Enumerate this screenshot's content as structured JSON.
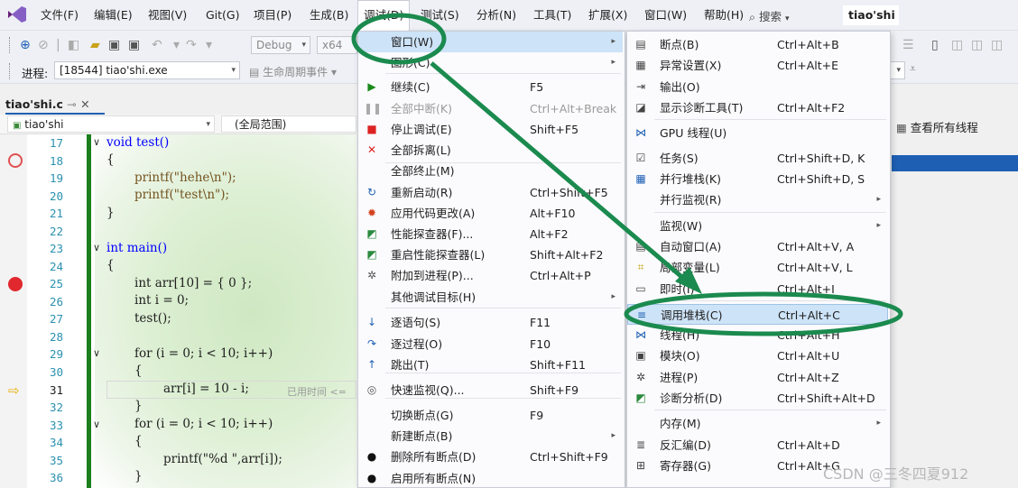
{
  "menubar": {
    "items": [
      "文件(F)",
      "编辑(E)",
      "视图(V)",
      "Git(G)",
      "项目(P)",
      "生成(B)",
      "调试(D)",
      "测试(S)",
      "分析(N)",
      "工具(T)",
      "扩展(X)",
      "窗口(W)",
      "帮助(H)"
    ],
    "search": "搜索",
    "solution": "tiao'shi"
  },
  "toolbar": {
    "config": "Debug",
    "platform": "x64",
    "process_label": "进程:",
    "process_value": "[18544] tiao'shi.exe",
    "lifecycle": "生命周期事件",
    "threads_button": "查看所有线程"
  },
  "editor": {
    "tab": "tiao'shi.c",
    "project_combo": "tiao'shi",
    "scope_combo": "(全局范围)",
    "lines": [
      {
        "n": "17",
        "text": "void test()"
      },
      {
        "n": "18",
        "text": "{"
      },
      {
        "n": "19",
        "text": "printf(\"hehe\\n\");"
      },
      {
        "n": "20",
        "text": "printf(\"test\\n\");"
      },
      {
        "n": "21",
        "text": "}"
      },
      {
        "n": "22",
        "text": ""
      },
      {
        "n": "23",
        "text": "int main()"
      },
      {
        "n": "24",
        "text": "{"
      },
      {
        "n": "25",
        "text": "int arr[10] = { 0 };"
      },
      {
        "n": "26",
        "text": "int i = 0;"
      },
      {
        "n": "27",
        "text": "test();"
      },
      {
        "n": "28",
        "text": ""
      },
      {
        "n": "29",
        "text": "for (i = 0; i < 10; i++)"
      },
      {
        "n": "30",
        "text": "{"
      },
      {
        "n": "31",
        "text": "arr[i] = 10 - i;"
      },
      {
        "n": "32",
        "text": "}"
      },
      {
        "n": "33",
        "text": "for (i = 0; i < 10; i++)"
      },
      {
        "n": "34",
        "text": "{"
      },
      {
        "n": "35",
        "text": "printf(\"%d \",arr[i]);"
      },
      {
        "n": "36",
        "text": "}"
      }
    ],
    "elapsed_hint": "已用时间 <="
  },
  "debug_menu": [
    {
      "label": "窗口(W)",
      "shortcut": "",
      "sub": true,
      "icon": ""
    },
    {
      "label": "图形(C)",
      "shortcut": "",
      "sub": true,
      "icon": ""
    },
    {
      "label": "继续(C)",
      "shortcut": "F5",
      "icon": "play-icon"
    },
    {
      "label": "全部中断(K)",
      "shortcut": "Ctrl+Alt+Break",
      "disabled": true,
      "icon": "pause-icon"
    },
    {
      "label": "停止调试(E)",
      "shortcut": "Shift+F5",
      "icon": "stop-icon"
    },
    {
      "label": "全部拆离(L)",
      "shortcut": "",
      "icon": "close-icon"
    },
    {
      "label": "全部终止(M)",
      "shortcut": "",
      "icon": ""
    },
    {
      "label": "重新启动(R)",
      "shortcut": "Ctrl+Shift+F5",
      "icon": "restart-icon"
    },
    {
      "label": "应用代码更改(A)",
      "shortcut": "Alt+F10",
      "icon": "flame-icon"
    },
    {
      "label": "性能探查器(F)...",
      "shortcut": "Alt+F2",
      "icon": "profiler-icon"
    },
    {
      "label": "重启性能探查器(L)",
      "shortcut": "Shift+Alt+F2",
      "icon": "profiler-icon"
    },
    {
      "label": "附加到进程(P)...",
      "shortcut": "Ctrl+Alt+P",
      "icon": "gears-icon"
    },
    {
      "label": "其他调试目标(H)",
      "shortcut": "",
      "sub": true,
      "icon": ""
    },
    {
      "label": "逐语句(S)",
      "shortcut": "F11",
      "icon": "step-into-icon"
    },
    {
      "label": "逐过程(O)",
      "shortcut": "F10",
      "icon": "step-over-icon"
    },
    {
      "label": "跳出(T)",
      "shortcut": "Shift+F11",
      "icon": "step-out-icon"
    },
    {
      "label": "快速监视(Q)...",
      "shortcut": "Shift+F9",
      "icon": "glasses-icon"
    },
    {
      "label": "切换断点(G)",
      "shortcut": "F9",
      "icon": ""
    },
    {
      "label": "新建断点(B)",
      "shortcut": "",
      "sub": true,
      "icon": ""
    },
    {
      "label": "删除所有断点(D)",
      "shortcut": "Ctrl+Shift+F9",
      "icon": "delete-breakpoints-icon"
    },
    {
      "label": "启用所有断点(N)",
      "shortcut": "",
      "icon": "breakpoint-icon"
    }
  ],
  "window_menu": [
    {
      "label": "断点(B)",
      "shortcut": "Ctrl+Alt+B",
      "icon": "breakpoints-window-icon"
    },
    {
      "label": "异常设置(X)",
      "shortcut": "Ctrl+Alt+E",
      "icon": "exception-icon"
    },
    {
      "label": "输出(O)",
      "shortcut": "",
      "icon": "output-icon"
    },
    {
      "label": "显示诊断工具(T)",
      "shortcut": "Ctrl+Alt+F2",
      "icon": "diagnostic-icon"
    },
    {
      "label": "GPU 线程(U)",
      "shortcut": "",
      "icon": "gpu-threads-icon"
    },
    {
      "label": "任务(S)",
      "shortcut": "Ctrl+Shift+D, K",
      "icon": "tasks-icon"
    },
    {
      "label": "并行堆栈(K)",
      "shortcut": "Ctrl+Shift+D, S",
      "icon": "parallel-stacks-icon"
    },
    {
      "label": "并行监视(R)",
      "shortcut": "",
      "sub": true,
      "icon": ""
    },
    {
      "label": "监视(W)",
      "shortcut": "",
      "sub": true,
      "icon": ""
    },
    {
      "label": "自动窗口(A)",
      "shortcut": "Ctrl+Alt+V, A",
      "icon": "autos-icon"
    },
    {
      "label": "局部变量(L)",
      "shortcut": "Ctrl+Alt+V, L",
      "icon": "locals-icon"
    },
    {
      "label": "即时(I)",
      "shortcut": "Ctrl+Alt+I",
      "icon": "immediate-icon"
    },
    {
      "label": "调用堆栈(C)",
      "shortcut": "Ctrl+Alt+C",
      "icon": "call-stack-icon",
      "highlight": true
    },
    {
      "label": "线程(H)",
      "shortcut": "Ctrl+Alt+H",
      "icon": "threads-icon"
    },
    {
      "label": "模块(O)",
      "shortcut": "Ctrl+Alt+U",
      "icon": "modules-icon"
    },
    {
      "label": "进程(P)",
      "shortcut": "Ctrl+Alt+Z",
      "icon": "process-icon"
    },
    {
      "label": "诊断分析(D)",
      "shortcut": "Ctrl+Shift+Alt+D",
      "icon": "diagnostics-analysis-icon"
    },
    {
      "label": "内存(M)",
      "shortcut": "",
      "sub": true,
      "icon": ""
    },
    {
      "label": "反汇编(D)",
      "shortcut": "Ctrl+Alt+D",
      "icon": "disassembly-icon"
    },
    {
      "label": "寄存器(G)",
      "shortcut": "Ctrl+Alt+G",
      "icon": "registers-icon"
    }
  ],
  "watermark": "CSDN @三冬四夏912"
}
